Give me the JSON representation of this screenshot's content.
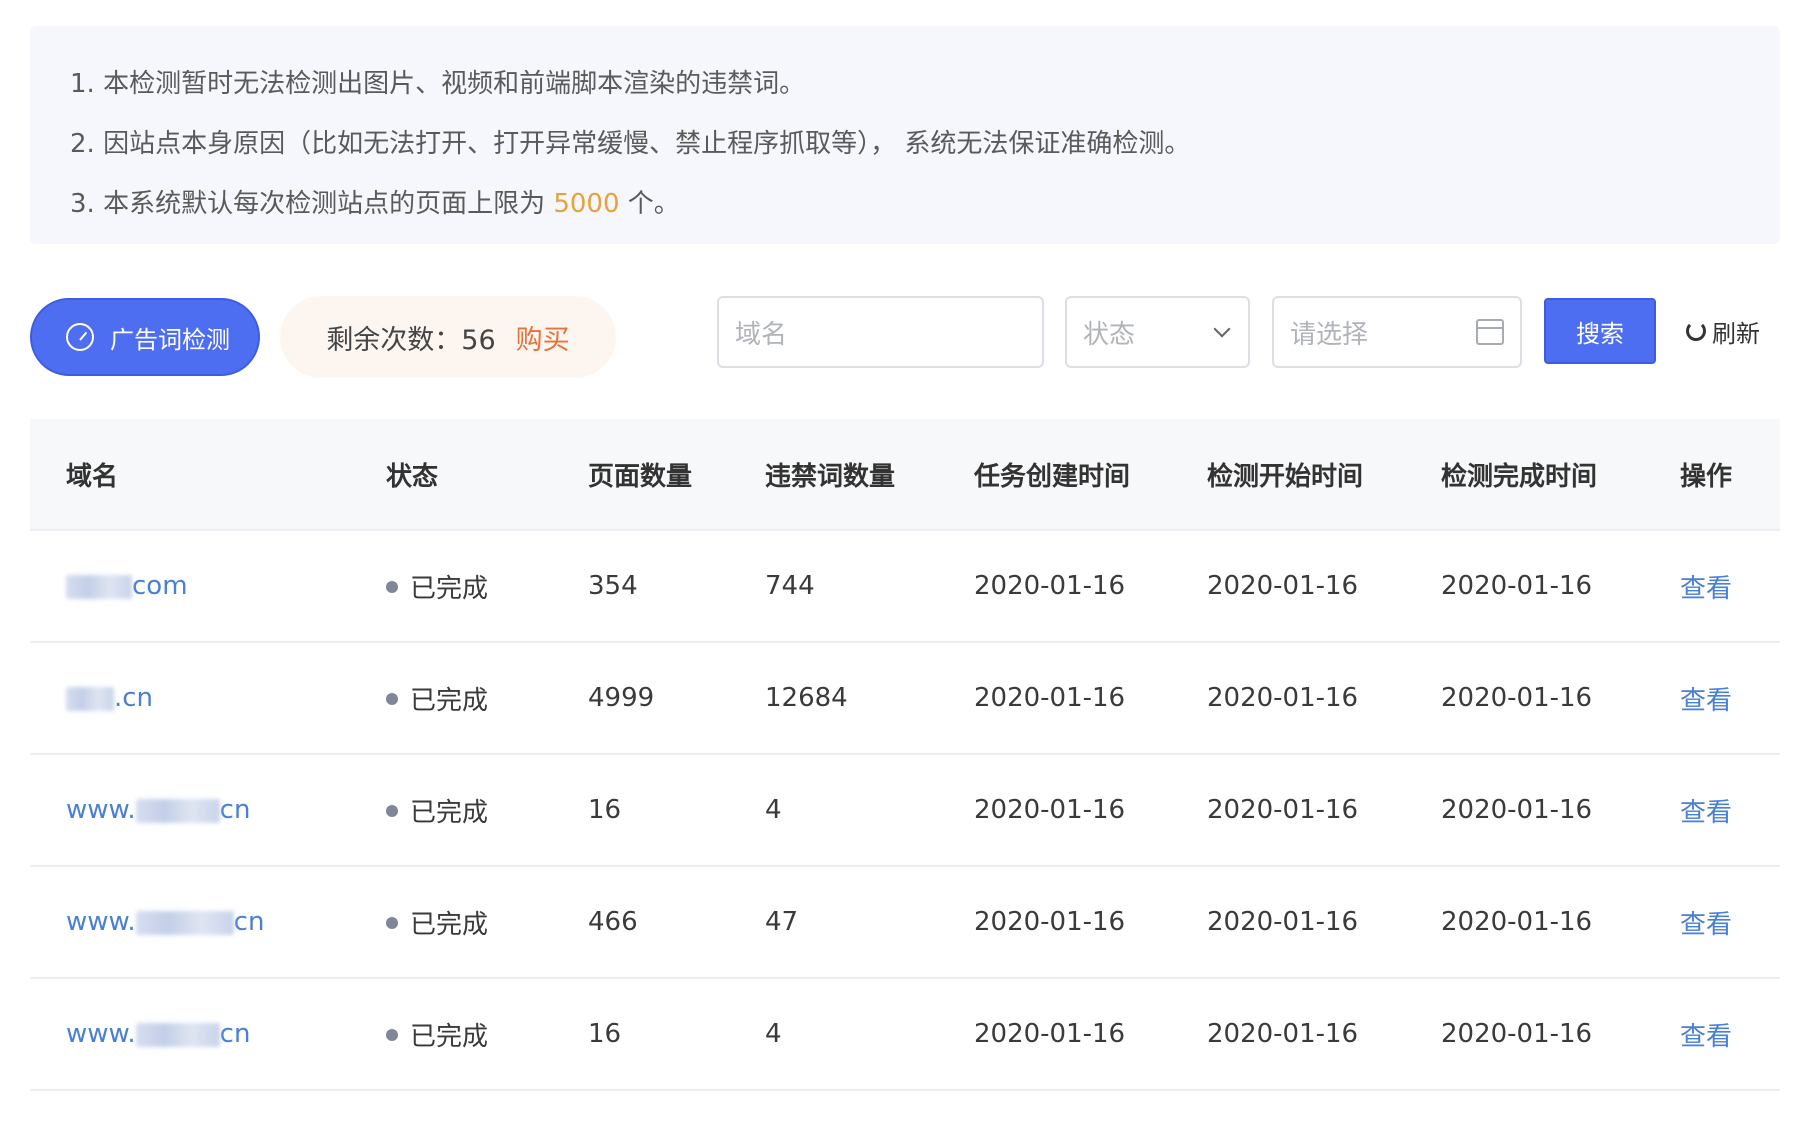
{
  "notice": {
    "line1": "1. 本检测暂时无法检测出图片、视频和前端脚本渲染的违禁词。",
    "line2": "2. 因站点本身原因（比如无法打开、打开异常缓慢、禁止程序抓取等）， 系统无法保证准确检测。",
    "line3_prefix": "3. 本系统默认每次检测站点的页面上限为 ",
    "line3_limit": "5000",
    "line3_suffix": " 个。"
  },
  "toolbar": {
    "detect_label": "广告词检测",
    "remain_label": "剩余次数：56",
    "buy_label": "购买",
    "domain_placeholder": "域名",
    "status_placeholder": "状态",
    "date_placeholder": "请选择",
    "search_label": "搜索",
    "refresh_label": "刷新"
  },
  "colors": {
    "primary": "#4e6ef2",
    "link": "#4a7fd6",
    "highlight": "#e6a23c",
    "buy": "#e8723a"
  },
  "table": {
    "headers": [
      "域名",
      "状态",
      "页面数量",
      "违禁词数量",
      "任务创建时间",
      "检测开始时间",
      "检测完成时间",
      "操作"
    ],
    "rows": [
      {
        "domain_prefix": "",
        "domain_suffix": "com",
        "status": "已完成",
        "pages": "354",
        "words": "744",
        "created": "2020-01-16",
        "started": "2020-01-16",
        "finished": "2020-01-16",
        "action": "查看"
      },
      {
        "domain_prefix": "",
        "domain_suffix": ".cn",
        "status": "已完成",
        "pages": "4999",
        "words": "12684",
        "created": "2020-01-16",
        "started": "2020-01-16",
        "finished": "2020-01-16",
        "action": "查看"
      },
      {
        "domain_prefix": "www.",
        "domain_suffix": "cn",
        "status": "已完成",
        "pages": "16",
        "words": "4",
        "created": "2020-01-16",
        "started": "2020-01-16",
        "finished": "2020-01-16",
        "action": "查看"
      },
      {
        "domain_prefix": "www.",
        "domain_suffix": "cn",
        "status": "已完成",
        "pages": "466",
        "words": "47",
        "created": "2020-01-16",
        "started": "2020-01-16",
        "finished": "2020-01-16",
        "action": "查看"
      },
      {
        "domain_prefix": "www.",
        "domain_suffix": "cn",
        "status": "已完成",
        "pages": "16",
        "words": "4",
        "created": "2020-01-16",
        "started": "2020-01-16",
        "finished": "2020-01-16",
        "action": "查看"
      }
    ]
  }
}
